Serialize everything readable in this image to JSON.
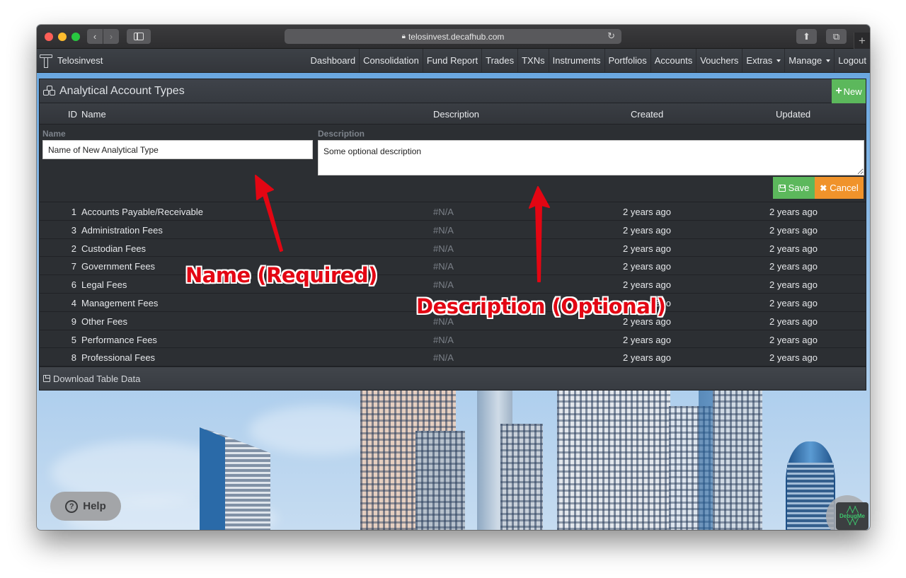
{
  "browser": {
    "url": "telosinvest.decafhub.com",
    "icons": {
      "back": "chevron-left-icon",
      "forward": "chevron-right-icon",
      "sidebar": "sidebar-icon",
      "lock": "lock-icon",
      "reload": "reload-icon",
      "share": "share-icon",
      "tabs": "tabs-icon",
      "new_tab": "plus-icon"
    }
  },
  "navbar": {
    "brand": "Telosinvest",
    "items": [
      {
        "label": "Dashboard"
      },
      {
        "label": "Consolidation"
      },
      {
        "label": "Fund Report"
      },
      {
        "label": "Trades"
      },
      {
        "label": "TXNs"
      },
      {
        "label": "Instruments"
      },
      {
        "label": "Portfolios"
      },
      {
        "label": "Accounts"
      },
      {
        "label": "Vouchers"
      },
      {
        "label": "Extras",
        "dropdown": true
      },
      {
        "label": "Manage",
        "dropdown": true
      },
      {
        "label": "Logout"
      }
    ]
  },
  "panel": {
    "title": "Analytical Account Types",
    "title_icon": "cubes-icon",
    "new_button": "New",
    "columns": {
      "id": "ID",
      "name": "Name",
      "description": "Description",
      "created": "Created",
      "updated": "Updated"
    },
    "form": {
      "name_label": "Name",
      "name_value": "Name of New Analytical Type",
      "description_label": "Description",
      "description_value": "Some optional description",
      "save_button": "Save",
      "cancel_button": "Cancel"
    },
    "rows": [
      {
        "id": "1",
        "name": "Accounts Payable/Receivable",
        "description": "#N/A",
        "created": "2 years ago",
        "updated": "2 years ago"
      },
      {
        "id": "3",
        "name": "Administration Fees",
        "description": "#N/A",
        "created": "2 years ago",
        "updated": "2 years ago"
      },
      {
        "id": "2",
        "name": "Custodian Fees",
        "description": "#N/A",
        "created": "2 years ago",
        "updated": "2 years ago"
      },
      {
        "id": "7",
        "name": "Government Fees",
        "description": "#N/A",
        "created": "2 years ago",
        "updated": "2 years ago"
      },
      {
        "id": "6",
        "name": "Legal Fees",
        "description": "#N/A",
        "created": "2 years ago",
        "updated": "2 years ago"
      },
      {
        "id": "4",
        "name": "Management Fees",
        "description": "#N/A",
        "created": "2 years ago",
        "updated": "2 years ago"
      },
      {
        "id": "9",
        "name": "Other Fees",
        "description": "#N/A",
        "created": "2 years ago",
        "updated": "2 years ago"
      },
      {
        "id": "5",
        "name": "Performance Fees",
        "description": "#N/A",
        "created": "2 years ago",
        "updated": "2 years ago"
      },
      {
        "id": "8",
        "name": "Professional Fees",
        "description": "#N/A",
        "created": "2 years ago",
        "updated": "2 years ago"
      }
    ],
    "download_label": "Download Table Data"
  },
  "widgets": {
    "help_label": "Help",
    "debug_label": "DebugMe"
  },
  "annotations": {
    "name_note": "Name (Required)",
    "description_note": "Description (Optional)",
    "color": "#e30613"
  },
  "colors": {
    "success": "#5cb85c",
    "warning": "#f0932b",
    "panel_bg": "#2c2f33",
    "navbar_bg": "#3a3d42"
  }
}
